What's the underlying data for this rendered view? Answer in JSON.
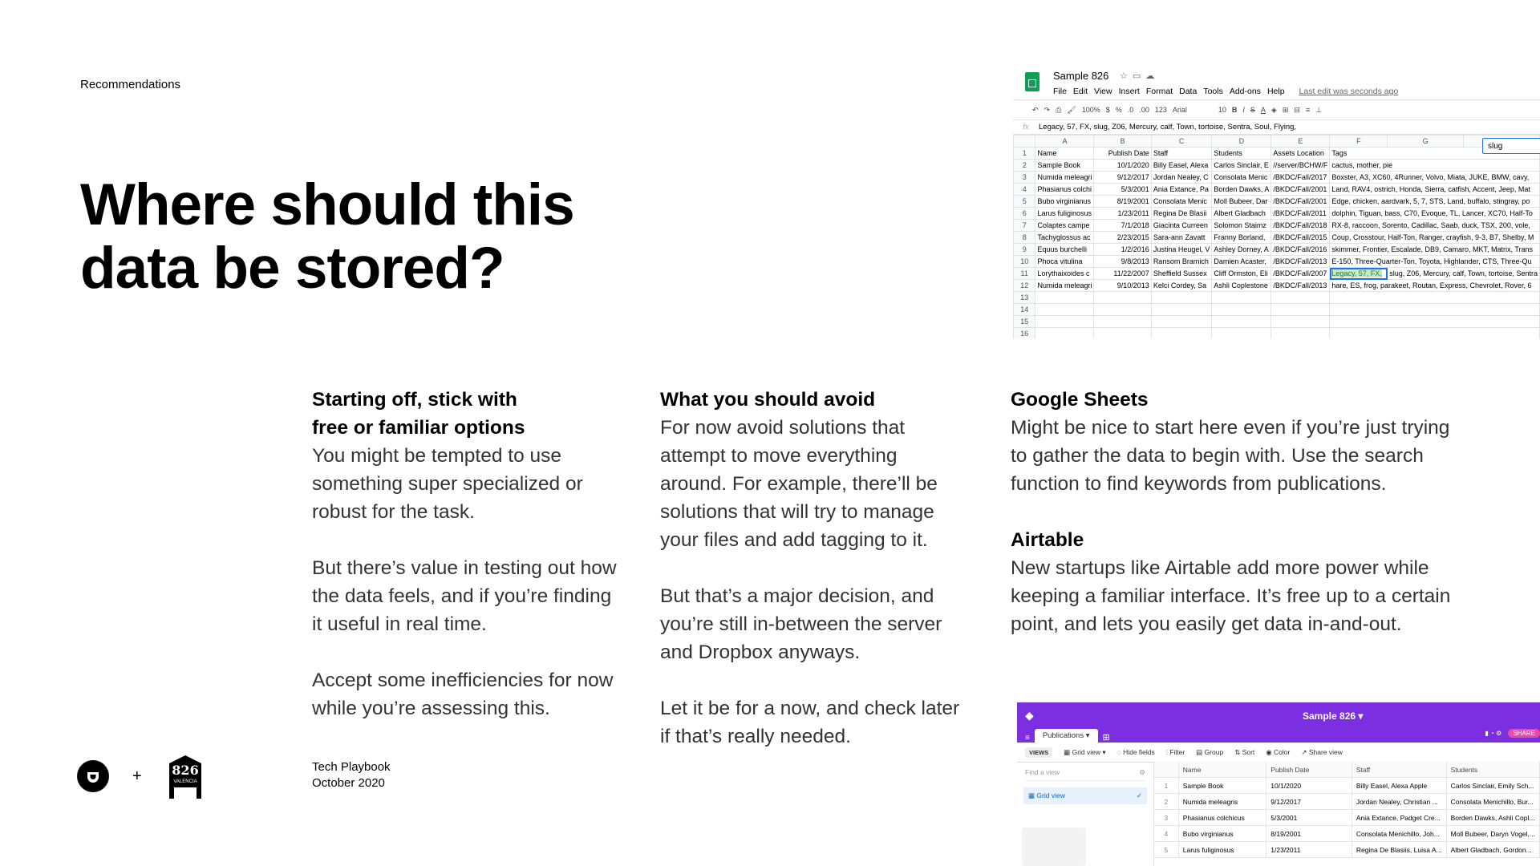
{
  "eyebrow": "Recommendations",
  "headline": {
    "line1": "Where should this",
    "line2": "data be stored?"
  },
  "col1": {
    "heading1": "Starting off, stick with",
    "heading2": "free or familiar options",
    "p1": "You might be tempted to use something super specialized or robust for the task.",
    "p2": "But there’s value in testing out how the data feels, and if you’re finding it useful in real time.",
    "p3": "Accept some inefficiencies for now while you’re assessing this."
  },
  "col2": {
    "heading": "What you should avoid",
    "p1": "For now avoid solutions that attempt to move everything around. For example, there’ll be solutions that will try to manage your files and add tagging to it.",
    "p2": "But that’s a major decision, and you’re still in-between the server and Dropbox anyways.",
    "p3": "Let it be for a now, and check later if that’s really needed."
  },
  "col3": {
    "heading1": "Google Sheets",
    "p1": "Might be nice to start here even if you’re just trying to gather the data to begin with. Use the search function to find keywords from publications.",
    "heading2": "Airtable",
    "p2": "New startups like Airtable add more power while keeping a familiar interface. It’s free up to a certain point, and lets you easily get data in-and-out."
  },
  "footer": {
    "plus": "+",
    "logo_text": "826",
    "logo_sub": "VALENCIA",
    "line1": "Tech Playbook",
    "line2": "October 2020"
  },
  "sheets": {
    "title": "Sample 826",
    "menu": [
      "File",
      "Edit",
      "View",
      "Insert",
      "Format",
      "Data",
      "Tools",
      "Add-ons",
      "Help"
    ],
    "last_edit": "Last edit was seconds ago",
    "toolbar": {
      "zoom": "100%",
      "currency": "$",
      "percent": "%",
      "dec1": ".0",
      "dec2": ".00",
      "fmt": "123",
      "font": "Arial",
      "size": "10"
    },
    "formula": "Legacy, 57, FX, slug, Z06, Mercury, calf, Town, tortoise, Sentra, Soul, Flying,",
    "search": "slug",
    "col_letters": [
      "A",
      "B",
      "C",
      "D",
      "E",
      "F",
      "G"
    ],
    "rows": [
      [
        "Name",
        "Publish Date",
        "Staff",
        "Students",
        "Assets Location",
        "Tags",
        ""
      ],
      [
        "Sample Book",
        "10/1/2020",
        "Billy Easel, Alexa",
        "Carlos Sinclair, E",
        "//server/BCHW/F",
        "cactus, mother, pie",
        ""
      ],
      [
        "Numida meleagri",
        "9/12/2017",
        "Jordan Nealey, C",
        "Consolata Menic",
        "/BKDC/Fall/2017",
        "Boxster, A3, XC60, 4Runner, Volvo, Miata, JUKE, BMW, cavy,",
        ""
      ],
      [
        "Phasianus colchi",
        "5/3/2001",
        "Ania Extance, Pa",
        "Borden Dawks, A",
        "/BKDC/Fall/2001",
        "Land, RAV4, ostrich, Honda, Sierra, catfish, Accent, Jeep, Mat",
        ""
      ],
      [
        "Bubo virginianus",
        "8/19/2001",
        "Consolata Menic",
        "Moll Bubeer, Dar",
        "/BKDC/Fall/2001",
        "Edge, chicken, aardvark, 5, 7, STS, Land, buffalo, stingray, po",
        ""
      ],
      [
        "Larus fuliginosus",
        "1/23/2011",
        "Regina De Blasii",
        "Albert Gladbach",
        "/BKDC/Fall/2011",
        "dolphin, Tiguan, bass, C70, Evoque, TL, Lancer, XC70, Half-To",
        ""
      ],
      [
        "Colaptes campe",
        "7/1/2018",
        "Giacinta Curreen",
        "Solomon Staimz",
        "/BKDC/Fall/2018",
        "RX-8, raccoon, Sorento, Cadillac, Saab, duck, TSX, 200, vole,",
        ""
      ],
      [
        "Tachyglossus ac",
        "2/23/2015",
        "Sara-ann Zavatt",
        "Franny Borland,",
        "/BKDC/Fall/2015",
        "Coup, Crosstour, Half-Ton, Ranger, crayfish, 9-3, B7, Shelby, M",
        ""
      ],
      [
        "Equus burchelli",
        "1/2/2016",
        "Justina Heugel, V",
        "Ashley Dorney, A",
        "/BKDC/Fall/2016",
        "skimmer, Frontier, Escalade, DB9, Camaro, MKT, Matrix, Trans",
        ""
      ],
      [
        "Phoca vitulina",
        "9/8/2013",
        "Ransom Bramich",
        "Damien Acaster,",
        "/BKDC/Fall/2013",
        "E-150, Three-Quarter-Ton, Toyota, Highlander, CTS, Three-Qu",
        ""
      ],
      [
        "Lorythaixoides c",
        "11/22/2007",
        "Sheffield Sussex",
        "Cliff Ormston, Eli",
        "/BKDC/Fall/2007",
        "Legacy, 57, FX,",
        "slug, Z06, Mercury, calf, Town, tortoise, Sentra"
      ],
      [
        "Numida meleagri",
        "9/10/2013",
        "Kelci Cordey, Sa",
        "Ashli Coplestone",
        "/BKDC/Fall/2013",
        "hare, ES, frog, parakeet, Routan, Express, Chevrolet, Rover, 6",
        ""
      ],
      [
        "",
        "",
        "",
        "",
        "",
        "",
        ""
      ],
      [
        "",
        "",
        "",
        "",
        "",
        "",
        ""
      ],
      [
        "",
        "",
        "",
        "",
        "",
        "",
        ""
      ],
      [
        "",
        "",
        "",
        "",
        "",
        "",
        ""
      ]
    ]
  },
  "airtable": {
    "base_name": "Sample 826",
    "tab": "Publications",
    "share": "SHARE",
    "toolbar": {
      "views": "VIEWS",
      "grid": "Grid view",
      "hide": "Hide fields",
      "filter": "Filter",
      "group": "Group",
      "sort": "Sort",
      "color": "Color",
      "share": "Share view"
    },
    "find_placeholder": "Find a view",
    "side_view": "Grid view",
    "columns": [
      "",
      "Name",
      "Publish Date",
      "Staff",
      "Students"
    ],
    "rows": [
      [
        "1",
        "Sample Book",
        "10/1/2020",
        "Billy Easel, Alexa Apple",
        "Carlos Sinclair, Emily Sch..."
      ],
      [
        "2",
        "Numida meleagris",
        "9/12/2017",
        "Jordan Nealey, Christian ...",
        "Consolata Menichillo, Bur..."
      ],
      [
        "3",
        "Phasianus colchicus",
        "5/3/2001",
        "Ania Extance, Padget Cre...",
        "Borden Dawks, Ashli Copl..."
      ],
      [
        "4",
        "Bubo virginianus",
        "8/19/2001",
        "Consolata Menichillo, Joh...",
        "Moll Bubeer, Daryn Vogel,..."
      ],
      [
        "5",
        "Larus fuliginosus",
        "1/23/2011",
        "Regina De Blasiis, Luisa A...",
        "Albert Gladbach, Gordon..."
      ]
    ]
  }
}
